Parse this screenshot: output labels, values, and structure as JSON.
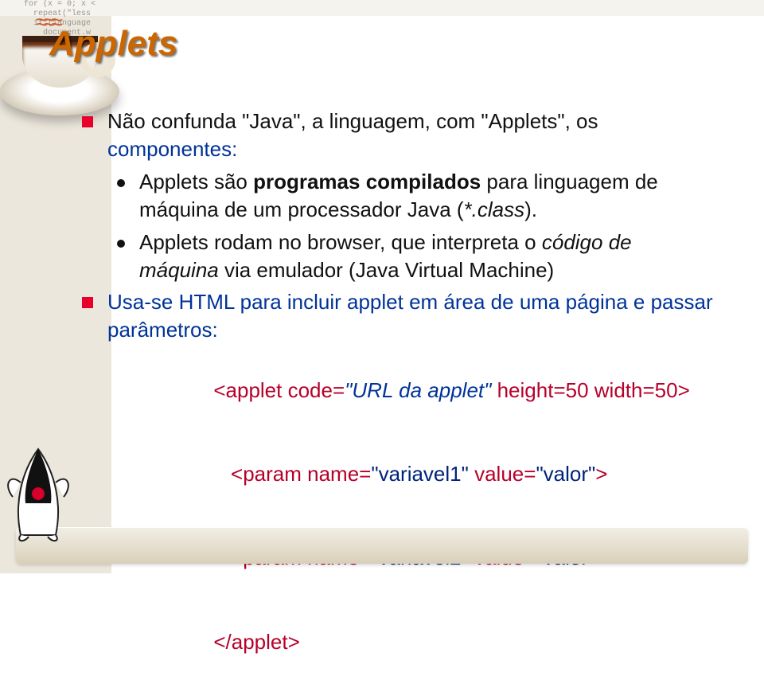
{
  "title": "Applets",
  "decor_code": "for (x = 0; x <\n  repeat(\"less\n  if (language\n    document.w",
  "bullets": [
    {
      "level": 1,
      "prefix": "Não confunda ",
      "q1": "\"Java\"",
      "mid1": ", a linguagem, com ",
      "q2": "\"Applets\"",
      "mid2": ", os ",
      "tail": "componentes:"
    },
    {
      "level": 2,
      "text_before": "Applets são ",
      "bold": "programas compilados",
      "text_after": " para linguagem de máquina de um processador Java (",
      "italic": "*.class",
      "close": ")."
    },
    {
      "level": 2,
      "text_before": "Applets rodam no browser, que interpreta o ",
      "italic": "código de máquina",
      "text_after": " via emulador (Java Virtual Machine)"
    },
    {
      "level": 1,
      "plain": "Usa-se HTML para incluir applet em área de uma página e passar parâmetros:"
    }
  ],
  "code": {
    "open_tag_start": "<applet code=",
    "open_tag_url": "\"URL da applet\"",
    "open_tag_end": " height=50 width=50>",
    "param1_start": "   <param name=",
    "param1_name": "\"variavel1\"",
    "param1_mid": " value=",
    "param1_value": "\"valor\"",
    "param1_end": ">",
    "param2_start": "   <param name=",
    "param2_name": "\"variavel2\"",
    "param2_mid": " value=",
    "param2_value": "\"valor\"",
    "param2_end": ">",
    "close_tag": "</applet>"
  }
}
